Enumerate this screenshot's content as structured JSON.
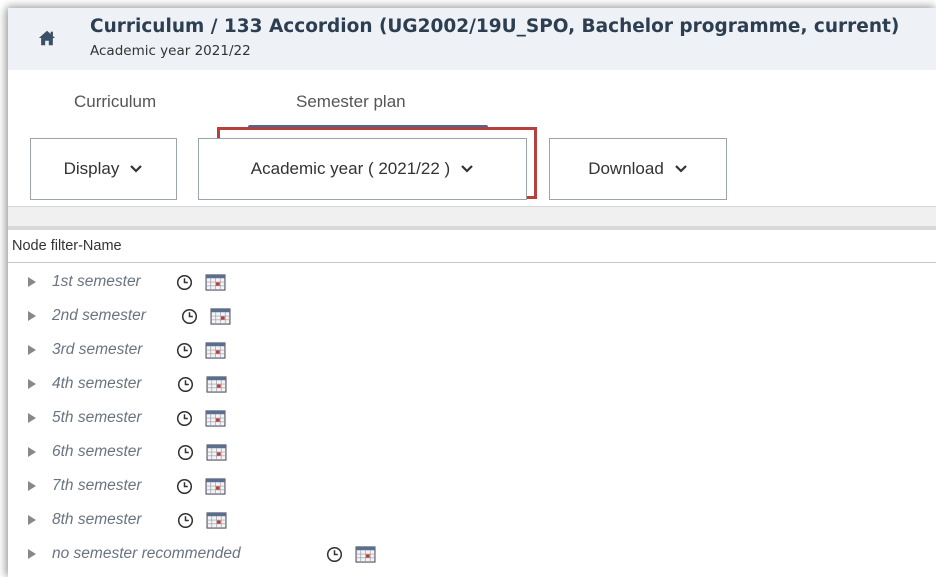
{
  "header": {
    "title": "Curriculum  / 133 Accordion (UG2002/19U_SPO, Bachelor programme, current)",
    "subtitle": "Academic year 2021/22"
  },
  "tabs": [
    {
      "label": "Curriculum",
      "active": false
    },
    {
      "label": "Semester plan",
      "active": true
    }
  ],
  "toolbar": {
    "display_label": "Display",
    "year_label": "Academic year ( 2021/22 )",
    "download_label": "Download"
  },
  "tree": {
    "column_header": "Node filter-Name",
    "nodes": [
      {
        "label": "1st semester"
      },
      {
        "label": "2nd semester"
      },
      {
        "label": "3rd semester"
      },
      {
        "label": "4th semester"
      },
      {
        "label": "5th semester"
      },
      {
        "label": "6th semester"
      },
      {
        "label": "7th semester"
      },
      {
        "label": "8th semester"
      },
      {
        "label": "no semester recommended"
      }
    ]
  },
  "colors": {
    "title": "#2c3e50",
    "header_bg": "#eef2f7",
    "highlight": "#b5403d",
    "tab_underline": "#4a6a8c",
    "node_text": "#6a7480"
  },
  "icons": {
    "home": "home-icon",
    "chevron": "chevron-down-icon",
    "clock": "clock-icon",
    "calendar": "calendar-icon",
    "expand": "expand-triangle-icon"
  }
}
